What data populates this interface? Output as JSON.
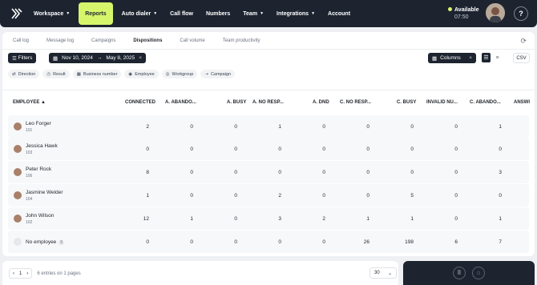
{
  "nav": {
    "items": [
      {
        "label": "Workspace",
        "dropdown": true
      },
      {
        "label": "Reports",
        "active": true
      },
      {
        "label": "Auto dialer",
        "dropdown": true
      },
      {
        "label": "Call flow"
      },
      {
        "label": "Numbers"
      },
      {
        "label": "Team",
        "dropdown": true
      },
      {
        "label": "Integrations",
        "dropdown": true
      },
      {
        "label": "Account"
      }
    ],
    "status": "Available",
    "time": "07:50",
    "help": "?"
  },
  "tabs": [
    "Call log",
    "Message log",
    "Campaigns",
    "Dispositions",
    "Call volume",
    "Team productivity"
  ],
  "active_tab": "Dispositions",
  "toolbar": {
    "filters_label": "Filters",
    "date_from": "Nov 10, 2024",
    "date_to": "May 8, 2025",
    "date_arrow": "→",
    "columns_label": "Columns",
    "csv_label": "CSV"
  },
  "chips": [
    "Direction",
    "Result",
    "Business number",
    "Employee",
    "Workgroup",
    "Campaign"
  ],
  "table": {
    "headers": [
      "EMPLOYEE ▲",
      "CONNECTED",
      "A. ABANDO...",
      "A. BUSY",
      "A. NO RESP...",
      "A. DND",
      "C. NO RESP...",
      "C. BUSY",
      "INVALID NU...",
      "C. ABANDO...",
      "ANSWI"
    ],
    "rows": [
      {
        "name": "Leo Forger",
        "ext": "101",
        "values": [
          "2",
          "0",
          "0",
          "1",
          "0",
          "0",
          "0",
          "0",
          "1"
        ]
      },
      {
        "name": "Jessica Hawk",
        "ext": "103",
        "values": [
          "0",
          "0",
          "0",
          "0",
          "0",
          "0",
          "0",
          "0",
          "0"
        ]
      },
      {
        "name": "Peter Rock",
        "ext": "106",
        "values": [
          "8",
          "0",
          "0",
          "0",
          "0",
          "0",
          "0",
          "0",
          "3"
        ]
      },
      {
        "name": "Jasmine Welder",
        "ext": "104",
        "values": [
          "1",
          "0",
          "0",
          "2",
          "0",
          "0",
          "5",
          "0",
          "0"
        ]
      },
      {
        "name": "John Wilson",
        "ext": "102",
        "values": [
          "12",
          "1",
          "0",
          "3",
          "2",
          "1",
          "1",
          "0",
          "1"
        ]
      },
      {
        "name": "No employee",
        "ext": "",
        "badge": "5",
        "values": [
          "0",
          "0",
          "0",
          "0",
          "0",
          "26",
          "198",
          "6",
          "7"
        ]
      }
    ]
  },
  "footer": {
    "page": "1",
    "summary": "6 entries on 1 pages",
    "per_page": "30"
  },
  "colors": {
    "accent": "#d7f56b",
    "dark": "#1d2430"
  }
}
